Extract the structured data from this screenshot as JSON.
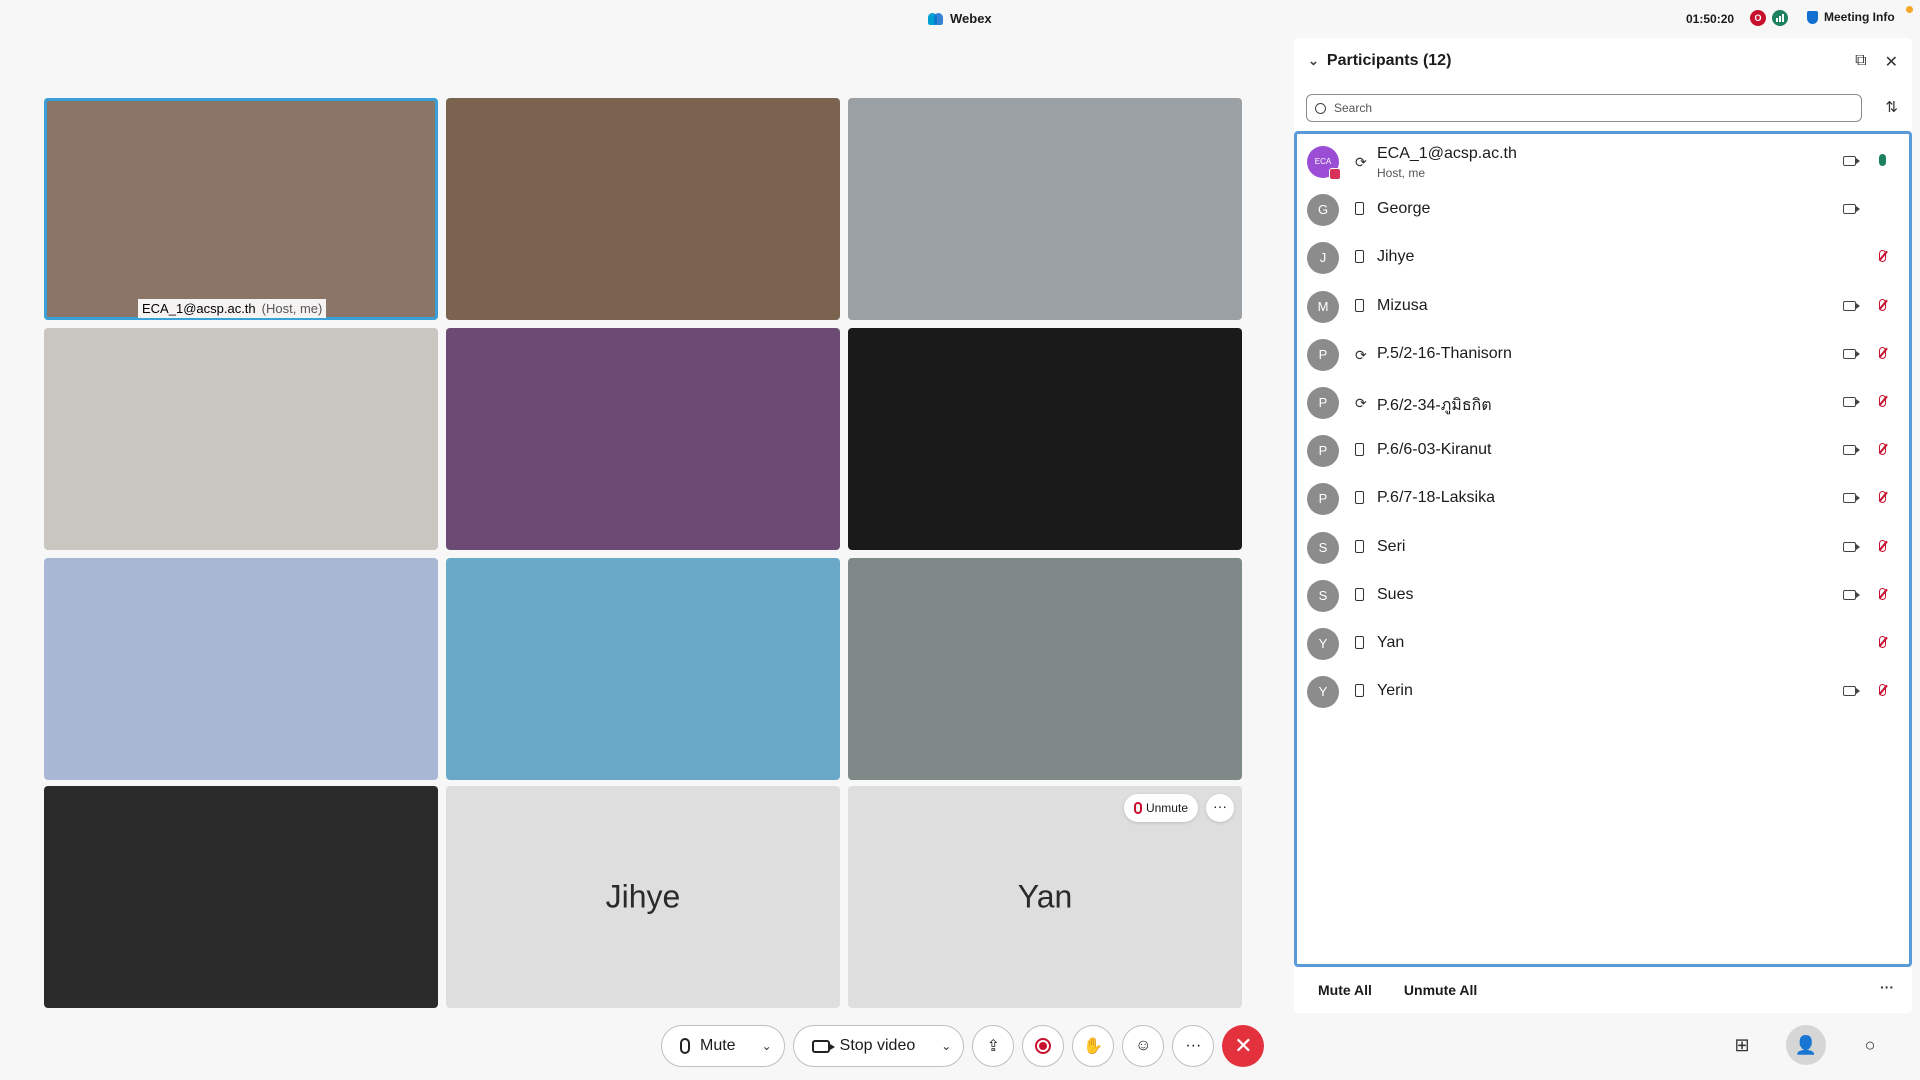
{
  "titlebar": {
    "app_name": "Webex",
    "clock": "01:50:20",
    "rec_badge": "O",
    "meeting_info": "Meeting Info"
  },
  "tiles": [
    {
      "label": "ECA_1@acsp.ac.th",
      "sublabel": "(Host, me)",
      "bg": "#8a7566"
    },
    {
      "bg": "#7a6450"
    },
    {
      "bg": "#9aa0a4"
    },
    {
      "bg": "#c9c6c2"
    },
    {
      "bg": "#6b4a73"
    },
    {
      "bg": "#1a1a1a"
    },
    {
      "bg": "#a8b7d4"
    },
    {
      "bg": "#6aa8c8"
    },
    {
      "bg": "#7f8a88"
    },
    {
      "bg": "#2a2a2a"
    },
    {
      "name": "Jihye"
    },
    {
      "name": "Yan",
      "unmute_label": "Unmute",
      "more": "···"
    }
  ],
  "controls": {
    "mute_label": "Mute",
    "video_label": "Stop video",
    "more": "···",
    "end": "✕"
  },
  "panel": {
    "title": "Participants (12)",
    "search_placeholder": "Search",
    "participants": [
      {
        "initial": "ECA",
        "name": "ECA_1@acsp.ac.th",
        "sub": "Host, me",
        "device": "sync",
        "video": true,
        "mic": "on"
      },
      {
        "initial": "G",
        "name": "George",
        "device": "phone",
        "video": true,
        "mic": "none"
      },
      {
        "initial": "J",
        "name": "Jihye",
        "device": "phone",
        "video": false,
        "mic": "off"
      },
      {
        "initial": "M",
        "name": "Mizusa",
        "device": "phone",
        "video": true,
        "mic": "off"
      },
      {
        "initial": "P",
        "name": "P.5/2-16-Thanisorn",
        "device": "sync",
        "video": true,
        "mic": "off"
      },
      {
        "initial": "P",
        "name": "P.6/2-34-ภูมิธกิต",
        "device": "sync",
        "video": true,
        "mic": "off"
      },
      {
        "initial": "P",
        "name": "P.6/6-03-Kiranut",
        "device": "phone",
        "video": true,
        "mic": "off"
      },
      {
        "initial": "P",
        "name": "P.6/7-18-Laksika",
        "device": "phone",
        "video": true,
        "mic": "off"
      },
      {
        "initial": "S",
        "name": "Seri",
        "device": "phone",
        "video": true,
        "mic": "off"
      },
      {
        "initial": "S",
        "name": "Sues",
        "device": "phone",
        "video": true,
        "mic": "off"
      },
      {
        "initial": "Y",
        "name": "Yan",
        "device": "phone",
        "video": false,
        "mic": "off"
      },
      {
        "initial": "Y",
        "name": "Yerin",
        "device": "phone",
        "video": true,
        "mic": "off"
      }
    ],
    "mute_all": "Mute All",
    "unmute_all": "Unmute All",
    "more": "···"
  },
  "bottom_right": {
    "more": "···"
  }
}
